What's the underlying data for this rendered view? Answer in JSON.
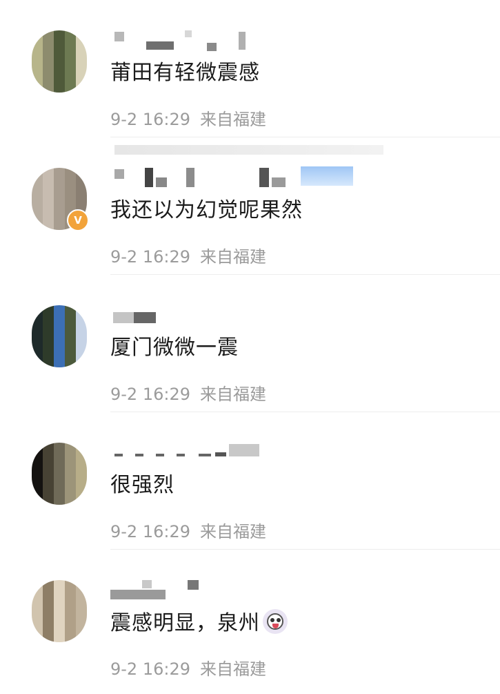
{
  "comments": [
    {
      "text": "莆田有轻微震感",
      "date": "9-2",
      "time": "16:29",
      "location": "来自福建",
      "verified": false,
      "emoji": null,
      "avatar_palette": [
        "#b7b58a",
        "#6d7a52",
        "#c9c3a2",
        "#8d8c6e",
        "#d8d2b8",
        "#9e9a7a",
        "#4f5a3a",
        "#e3dcc4"
      ]
    },
    {
      "text": "我还以为幻觉呢果然",
      "date": "9-2",
      "time": "16:29",
      "location": "来自福建",
      "verified": true,
      "verified_icon": "verified-v-badge-icon",
      "emoji": null,
      "avatar_palette": [
        "#d6d0c6",
        "#b8aea1",
        "#9a8f80",
        "#efe9e0",
        "#c7bcb0",
        "#8a7f72",
        "#e4ddd2",
        "#a89d90"
      ]
    },
    {
      "text": "厦门微微一震",
      "date": "9-2",
      "time": "16:29",
      "location": "来自福建",
      "verified": false,
      "emoji": null,
      "avatar_palette": [
        "#3c6fb5",
        "#5b8fd2",
        "#1e2a2a",
        "#4c5a3c",
        "#88a0c8",
        "#2e3b2a",
        "#c6d3e6",
        "#0f1414"
      ]
    },
    {
      "text": "很强烈",
      "date": "9-2",
      "time": "16:29",
      "location": "来自福建",
      "verified": false,
      "emoji": null,
      "avatar_palette": [
        "#2a2620",
        "#6f6a58",
        "#d9cfa6",
        "#141210",
        "#9c9479",
        "#f1ead0",
        "#474234",
        "#b7ad88"
      ]
    },
    {
      "text": "震感明显，泉州",
      "date": "9-2",
      "time": "16:29",
      "location": "来自福建",
      "verified": false,
      "emoji": "husky-emoji-icon",
      "avatar_palette": [
        "#c2b49e",
        "#9c8c74",
        "#e0d4c0",
        "#7d6d58",
        "#d1c4ae",
        "#b0a088",
        "#efe6d6",
        "#8e7e66"
      ]
    }
  ]
}
